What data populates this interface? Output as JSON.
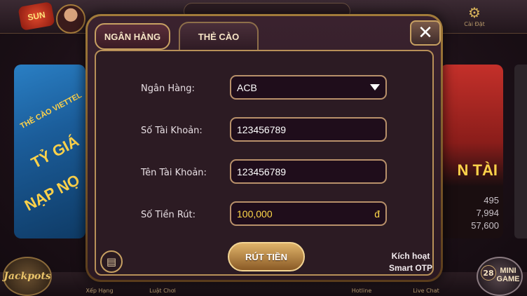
{
  "background": {
    "logo_text": "SUN",
    "settings_label": "Cài Đặt",
    "left_banner_lines": [
      "THẺ CÀO VIETTEL",
      "TỶ GIÁ",
      "NẠP NỌ"
    ],
    "right_banner_title": "N TÀI",
    "right_banner_numbers": [
      "495",
      "7,994",
      "57,600"
    ],
    "bottom_nav": [
      "Xếp Hạng",
      "Luật Chơi",
      "Hotline",
      "Live Chat"
    ],
    "jackpots_label": "Jackpots",
    "minigame_badge": "28",
    "minigame_label": "MINI GAME"
  },
  "dialog": {
    "tabs": [
      {
        "label": "NGÂN HÀNG",
        "active": true
      },
      {
        "label": "THẺ CÀO",
        "active": false
      }
    ],
    "close_symbol": "✕",
    "form": {
      "bank_label": "Ngân Hàng:",
      "bank_value": "ACB",
      "account_number_label": "Số Tài Khoản:",
      "account_number_value": "123456789",
      "account_name_label": "Tên Tài Khoản:",
      "account_name_value": "123456789",
      "amount_label": "Số Tiền Rút:",
      "amount_value": "100,000",
      "currency_symbol": "đ"
    },
    "withdraw_button": "RÚT TIỀN",
    "otp_line1": "Kích hoạt",
    "otp_line2": "Smart OTP"
  }
}
